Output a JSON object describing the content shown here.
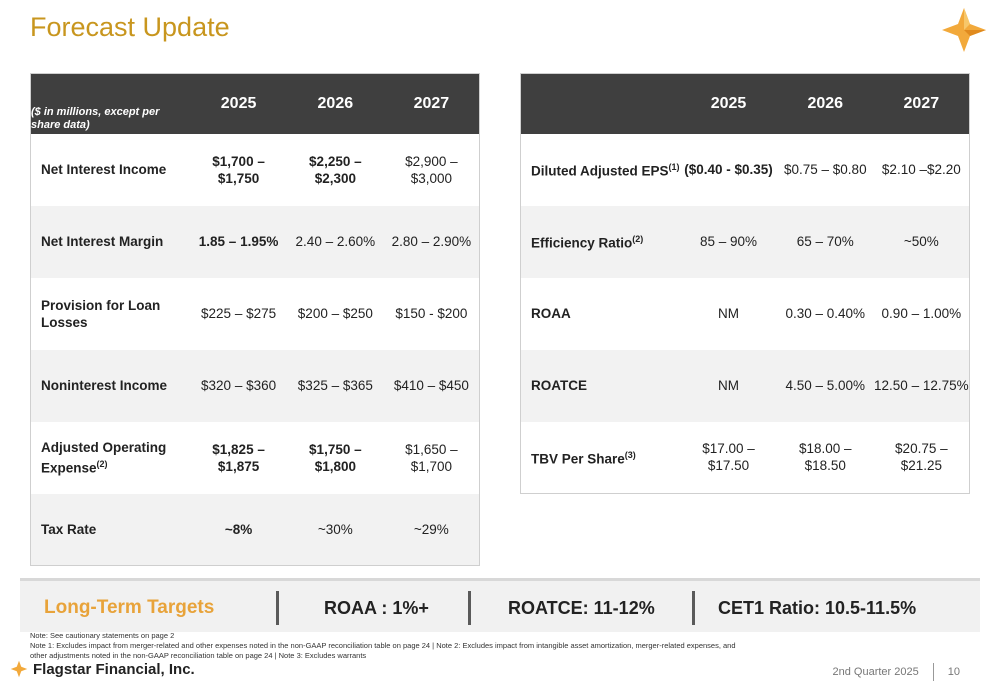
{
  "title": "Forecast Update",
  "left_table": {
    "corner_label": "($ in millions, except per share data)",
    "years": [
      "2025",
      "2026",
      "2027"
    ],
    "rows": [
      {
        "label": "Net Interest Income",
        "sup": "",
        "v1": "$1,700 – $1,750",
        "v2": "$2,250 – $2,300",
        "v3": "$2,900 – $3,000"
      },
      {
        "label": "Net Interest Margin",
        "sup": "",
        "v1": "1.85 – 1.95%",
        "v2": "2.40 – 2.60%",
        "v3": "2.80 – 2.90%"
      },
      {
        "label": "Provision for Loan Losses",
        "sup": "",
        "v1": "$225 – $275",
        "v2": "$200 – $250",
        "v3": "$150 - $200"
      },
      {
        "label": "Noninterest Income",
        "sup": "",
        "v1": "$320 – $360",
        "v2": "$325 – $365",
        "v3": "$410 – $450"
      },
      {
        "label": "Adjusted Operating Expense",
        "sup": "(2)",
        "v1": "$1,825 – $1,875",
        "v2": "$1,750 – $1,800",
        "v3": "$1,650 – $1,700"
      },
      {
        "label": "Tax Rate",
        "sup": "",
        "v1": "~8%",
        "v2": "~30%",
        "v3": "~29%"
      }
    ]
  },
  "right_table": {
    "years": [
      "2025",
      "2026",
      "2027"
    ],
    "rows": [
      {
        "label": "Diluted Adjusted EPS",
        "sup": "(1)",
        "v1": "($0.40 - $0.35)",
        "v2": "$0.75 – $0.80",
        "v3": "$2.10 –$2.20"
      },
      {
        "label": "Efficiency Ratio",
        "sup": "(2)",
        "v1": "85 – 90%",
        "v2": "65 – 70%",
        "v3": "~50%"
      },
      {
        "label": "ROAA",
        "sup": "",
        "v1": "NM",
        "v2": "0.30 – 0.40%",
        "v3": "0.90 – 1.00%"
      },
      {
        "label": "ROATCE",
        "sup": "",
        "v1": "NM",
        "v2": "4.50 – 5.00%",
        "v3": "12.50 – 12.75%"
      },
      {
        "label": "TBV Per Share",
        "sup": "(3)",
        "v1": "$17.00 – $17.50",
        "v2": "$18.00 – $18.50",
        "v3": "$20.75 – $21.25"
      }
    ]
  },
  "targets": {
    "label": "Long-Term Targets",
    "roaa": "ROAA : 1%+",
    "roatce": "ROATCE: 11-12%",
    "cet1": "CET1 Ratio: 10.5-11.5%"
  },
  "notes": {
    "line0": "Note: See cautionary statements on page 2",
    "line1": "Note 1: Excludes impact from merger-related and other expenses noted in the non-GAAP reconciliation table on page 24 | Note 2: Excludes impact from intangible asset amortization, merger-related expenses, and",
    "line2": "other adjustments noted in the non-GAAP reconciliation table on page 24   | Note 3: Excludes warrants"
  },
  "footer": {
    "brand": "Flagstar Financial, Inc.",
    "period": "2nd Quarter 2025",
    "page": "10"
  },
  "colors": {
    "title": "#c8961e",
    "header": "#3f3f3f",
    "accent": "#e8a33a",
    "logo": "#f2a93b"
  },
  "icons": {
    "logo": "four-point-star-icon"
  }
}
